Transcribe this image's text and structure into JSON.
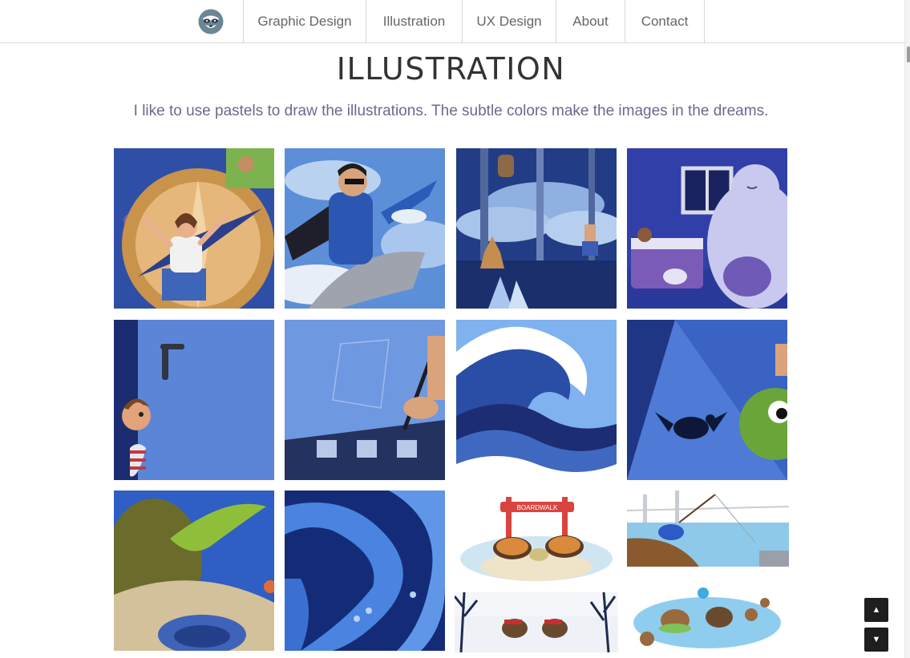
{
  "nav": {
    "logo_icon": "raccoon-logo-icon",
    "items": [
      {
        "label": "Graphic Design"
      },
      {
        "label": "Illustration"
      },
      {
        "label": "UX Design"
      },
      {
        "label": "About"
      },
      {
        "label": "Contact"
      }
    ]
  },
  "page": {
    "title": "ILLUSTRATION",
    "intro": "I like to use pastels to draw the illustrations. The subtle colors make the images in the dreams."
  },
  "gallery": {
    "images": [
      {
        "icon": "girl-compass-illustration"
      },
      {
        "icon": "boy-riding-plane-illustration"
      },
      {
        "icon": "night-forest-deer-illustration"
      },
      {
        "icon": "giant-cat-bedroom-illustration"
      },
      {
        "icon": "child-behind-door-illustration"
      },
      {
        "icon": "hand-drawing-illustration"
      },
      {
        "icon": "great-wave-illustration"
      },
      {
        "icon": "turtle-shadow-illustration"
      },
      {
        "icon": "sea-turtle-closeup-illustration"
      },
      {
        "icon": "tentacles-illustration"
      },
      {
        "icon": "boardwalk-turtles-illustration"
      },
      {
        "icon": "crab-fishing-illustration"
      },
      {
        "icon": "winter-hedgehogs-illustration"
      },
      {
        "icon": "beach-hedgehogs-illustration"
      }
    ],
    "boardwalk_sign": "BOARDWALK"
  },
  "controls": {
    "scroll_up_icon": "triangle-up-icon",
    "scroll_down_icon": "triangle-down-icon",
    "up_glyph": "▲",
    "down_glyph": "▼"
  },
  "colors": {
    "accent_text": "#73658f",
    "title": "#333333",
    "nav_text": "#666666"
  }
}
